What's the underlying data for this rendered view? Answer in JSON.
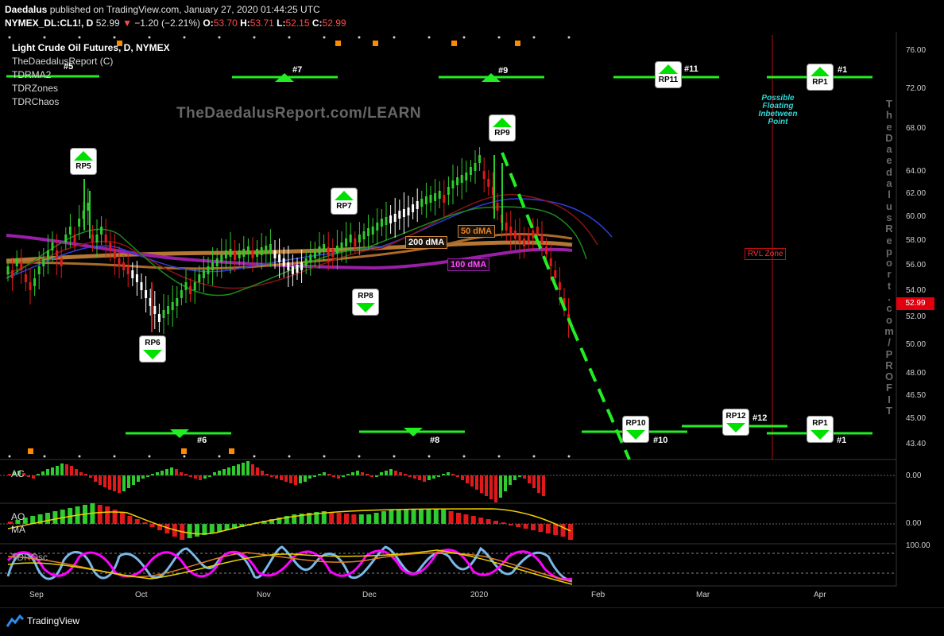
{
  "header": {
    "line1_user": "Daedalus",
    "line1_rest": " published on TradingView.com, January 27, 2020 01:44:25 UTC",
    "symbol": "NYMEX_DL:CL1!, D",
    "last": "52.99",
    "change": "−1.20 (−2.21%)",
    "o_label": "O:",
    "o_val": "53.70",
    "h_label": "H:",
    "h_val": "53.71",
    "l_label": "L:",
    "l_val": "52.15",
    "c_label": "C:",
    "c_val": "52.99"
  },
  "overlay": {
    "title": "Light Crude Oil Futures, D, NYMEX",
    "items": [
      "TheDaedalusReport (C)",
      "TDRMA2",
      "TDRZones",
      "TDRChaos"
    ]
  },
  "watermark": "TheDaedalusReport.com/LEARN",
  "vertical_watermark": "TheDaedalusReport.com/PROFIT",
  "note": {
    "l1": "Possible",
    "l2": "Floating",
    "l3": "Inbetween",
    "l4": "Point"
  },
  "rvl_zone": "RVL Zone",
  "ma_labels": {
    "ma200": "200 dMA",
    "ma50": "50 dMA",
    "ma100": "100 dMA"
  },
  "rp_labels": {
    "rp5": "RP5",
    "rp6": "RP6",
    "rp7": "RP7",
    "rp8": "RP8",
    "rp9": "RP9",
    "rp10": "RP10",
    "rp11": "RP11",
    "rp12": "RP12",
    "rp1a": "RP1",
    "rp1b": "RP1"
  },
  "zone_labels": {
    "z5": "#5",
    "z6": "#6",
    "z7": "#7",
    "z8": "#8",
    "z9": "#9",
    "z10": "#10",
    "z11": "#11",
    "z12": "#12",
    "z1a": "#1",
    "z1b": "#1"
  },
  "price_axis": [
    "76.00",
    "72.00",
    "68.00",
    "64.00",
    "62.00",
    "60.00",
    "58.00",
    "56.00",
    "54.00",
    "52.00",
    "50.00",
    "48.00",
    "46.50",
    "45.00",
    "43.40"
  ],
  "current_price": "52.99",
  "months": [
    "Sep",
    "Oct",
    "Nov",
    "Dec",
    "2020",
    "Feb",
    "Mar",
    "Apr"
  ],
  "panes": {
    "ac": {
      "label": "AC",
      "zero": "0.00"
    },
    "ao": {
      "label": "AO",
      "label2": "MA",
      "zero": "0.00"
    },
    "tdr": {
      "label": "TDROsc",
      "top": "100.00"
    }
  },
  "footer": {
    "brand": "TradingView"
  },
  "colors": {
    "up": "#2ecc2e",
    "down": "#e01a1a",
    "zone": "#22ee22",
    "ma200": "#c8843a",
    "ma100": "#9a1fa8",
    "rvl": "#b01010"
  }
}
